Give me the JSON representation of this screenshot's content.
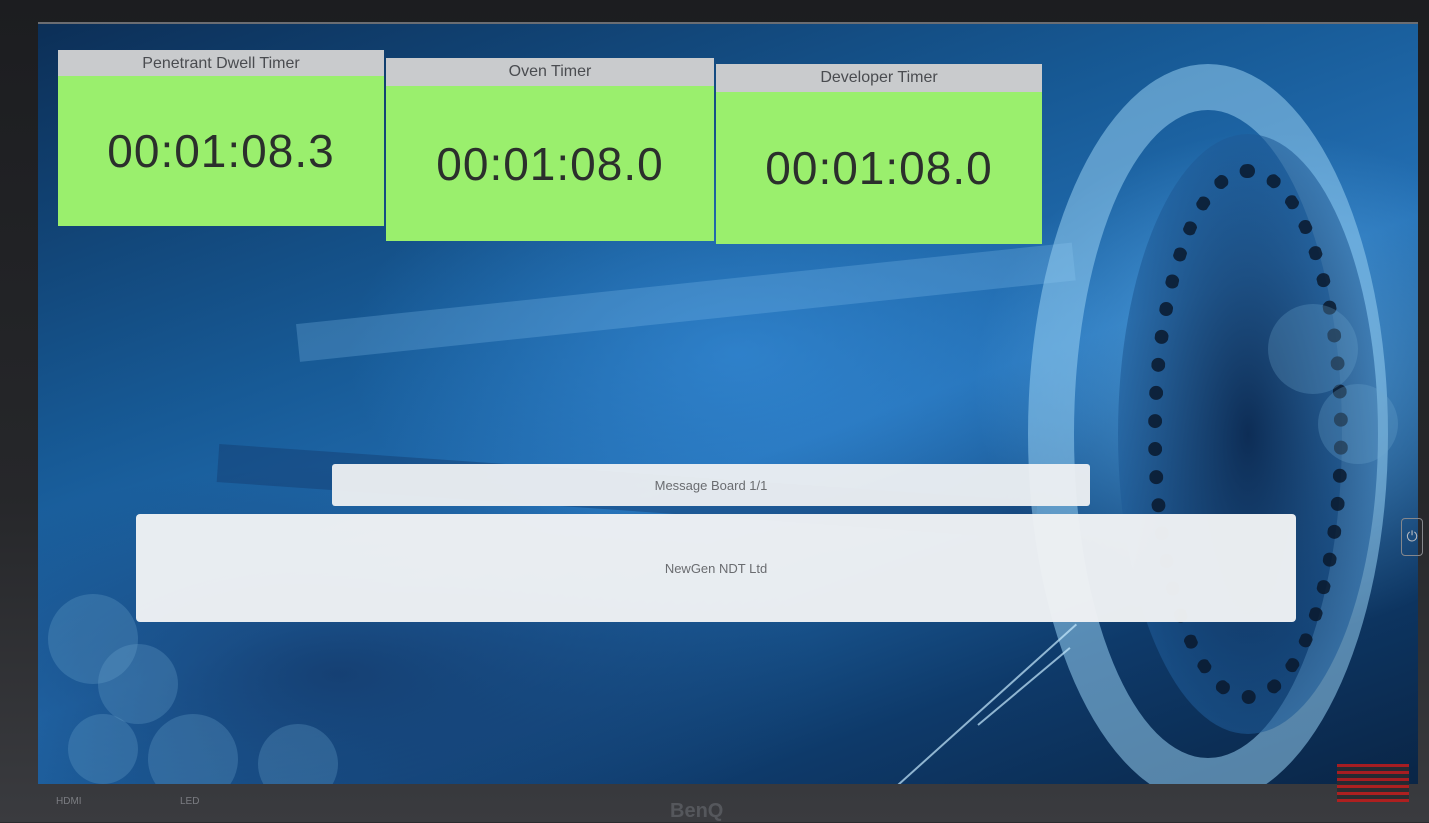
{
  "timers": [
    {
      "label": "Penetrant Dwell Timer",
      "value": "00:01:08.3"
    },
    {
      "label": "Oven Timer",
      "value": "00:01:08.0"
    },
    {
      "label": "Developer Timer",
      "value": "00:01:08.0"
    }
  ],
  "message_board": {
    "title": "Message Board 1/1",
    "message": "NewGen NDT Ltd"
  },
  "bezel": {
    "brand": "BenQ",
    "ports_label": "HDMI",
    "led_label": "LED"
  },
  "colors": {
    "timer_green": "#9aef6d",
    "tab_grey": "#c9cbcd",
    "background_blue": "#175a96"
  }
}
